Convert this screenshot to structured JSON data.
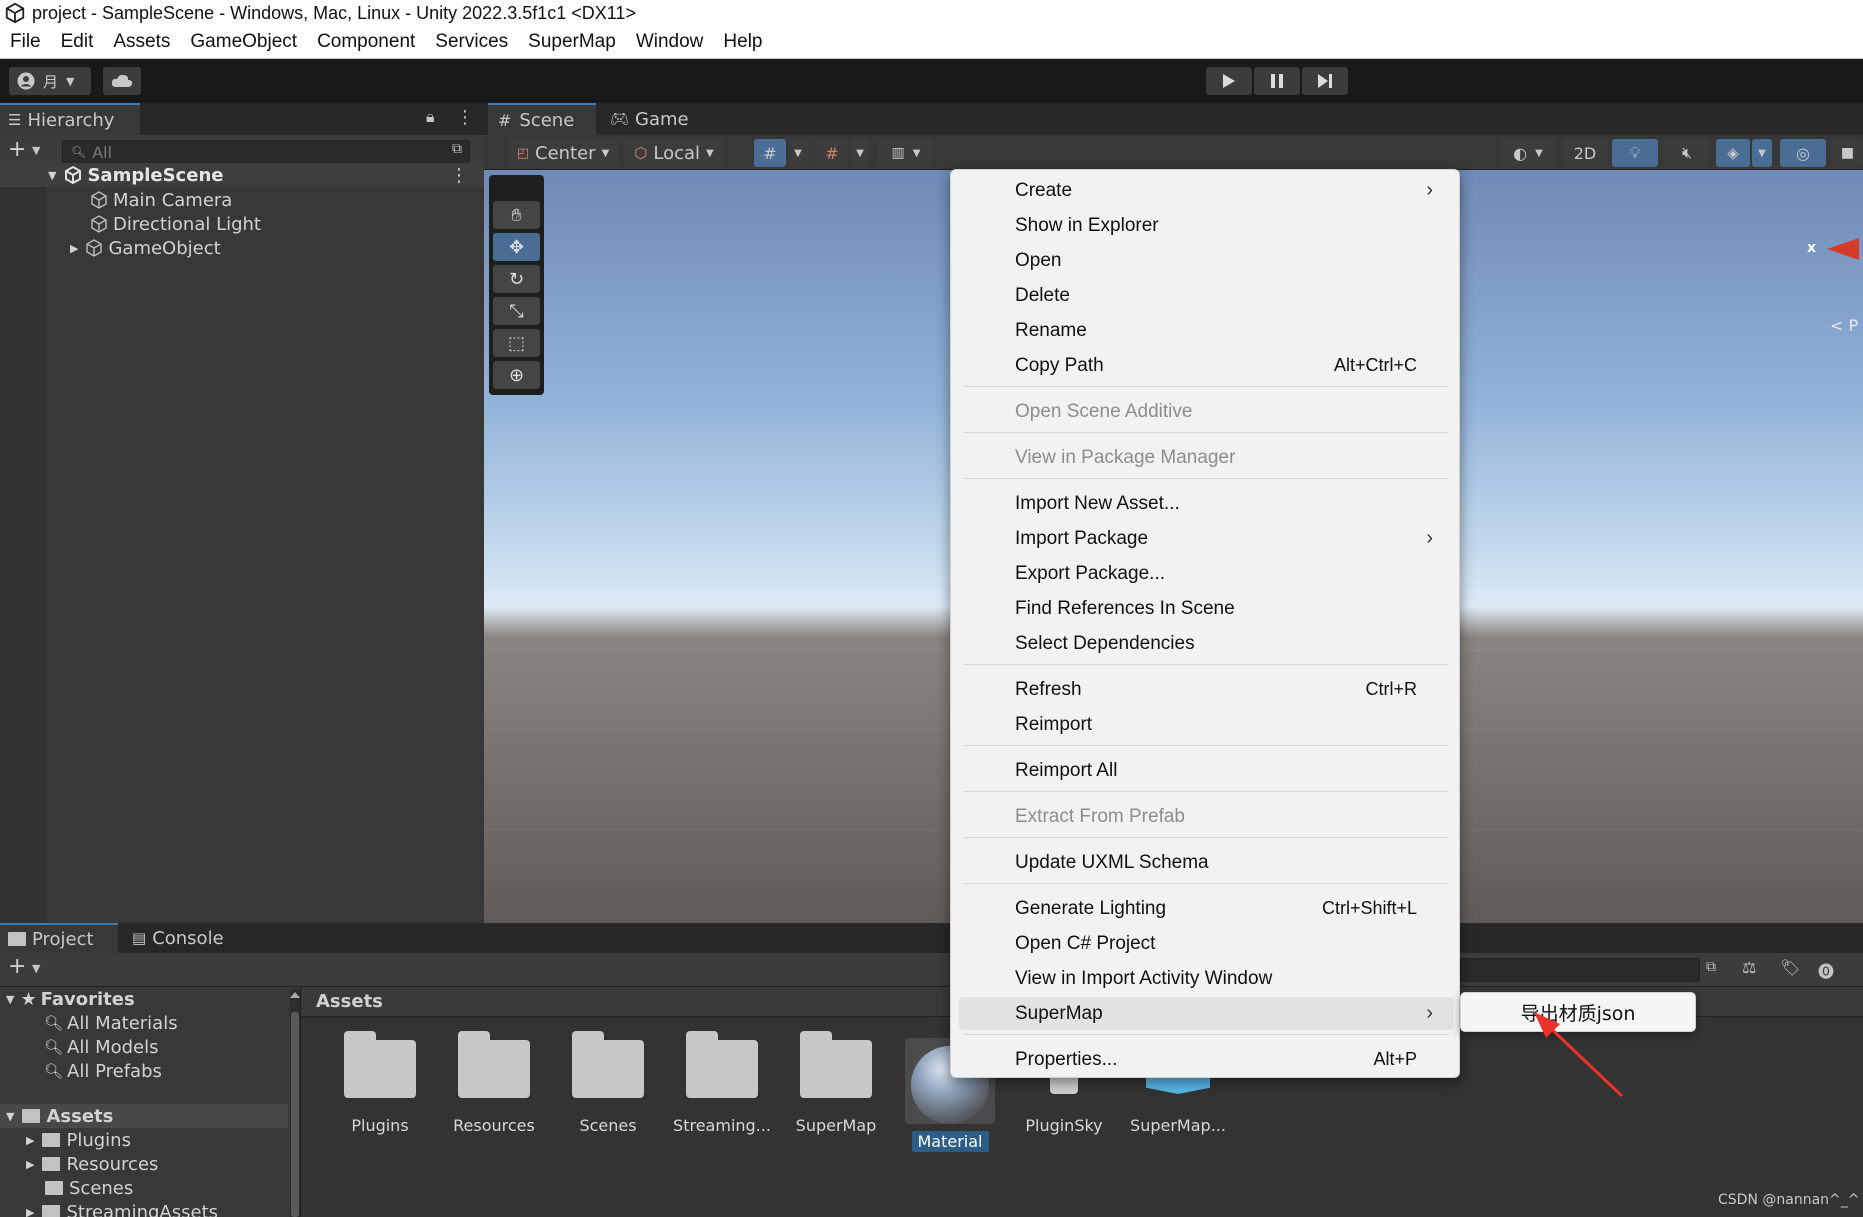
{
  "window": {
    "title": "project - SampleScene - Windows, Mac, Linux - Unity 2022.3.5f1c1 <DX11>"
  },
  "menubar": [
    "File",
    "Edit",
    "Assets",
    "GameObject",
    "Component",
    "Services",
    "SuperMap",
    "Window",
    "Help"
  ],
  "toolbar": {
    "account_label": "月"
  },
  "hierarchy": {
    "tab_label": "Hierarchy",
    "search_placeholder": "All",
    "scene_name": "SampleScene",
    "items": [
      "Main Camera",
      "Directional Light",
      "GameObject"
    ]
  },
  "scene_tabs": {
    "scene": "Scene",
    "game": "Game",
    "pivot": "Center",
    "space": "Local",
    "mode_2d": "2D",
    "axis_x": "x",
    "persp": "< P"
  },
  "context_menu": {
    "create": "Create",
    "show_in_explorer": "Show in Explorer",
    "open": "Open",
    "delete": "Delete",
    "rename": "Rename",
    "copy_path": "Copy Path",
    "copy_path_shortcut": "Alt+Ctrl+C",
    "open_scene_additive": "Open Scene Additive",
    "view_in_package_manager": "View in Package Manager",
    "import_new_asset": "Import New Asset...",
    "import_package": "Import Package",
    "export_package": "Export Package...",
    "find_references": "Find References In Scene",
    "select_dependencies": "Select Dependencies",
    "refresh": "Refresh",
    "refresh_shortcut": "Ctrl+R",
    "reimport": "Reimport",
    "reimport_all": "Reimport All",
    "extract_from_prefab": "Extract From Prefab",
    "update_uxml": "Update UXML Schema",
    "generate_lighting": "Generate Lighting",
    "generate_lighting_shortcut": "Ctrl+Shift+L",
    "open_csharp": "Open C# Project",
    "view_import_activity": "View in Import Activity Window",
    "supermap": "SuperMap",
    "properties": "Properties...",
    "properties_shortcut": "Alt+P"
  },
  "submenu": {
    "export_material_json": "导出材质json"
  },
  "project": {
    "tab_label": "Project",
    "console_label": "Console",
    "favorites": "Favorites",
    "favorites_items": [
      "All Materials",
      "All Models",
      "All Prefabs"
    ],
    "assets_root": "Assets",
    "assets_tree": [
      "Plugins",
      "Resources",
      "Scenes",
      "StreamingAssets"
    ],
    "breadcrumb": "Assets",
    "grid": [
      "Plugins",
      "Resources",
      "Scenes",
      "Streaming...",
      "SuperMap",
      "Material",
      "PluginSky",
      "SuperMap..."
    ]
  },
  "watermark": "CSDN @nannan^_^",
  "colors": {
    "selection": "#2c5d87",
    "accent_tab": "#3a79bb",
    "arrow": "#e8322b"
  }
}
